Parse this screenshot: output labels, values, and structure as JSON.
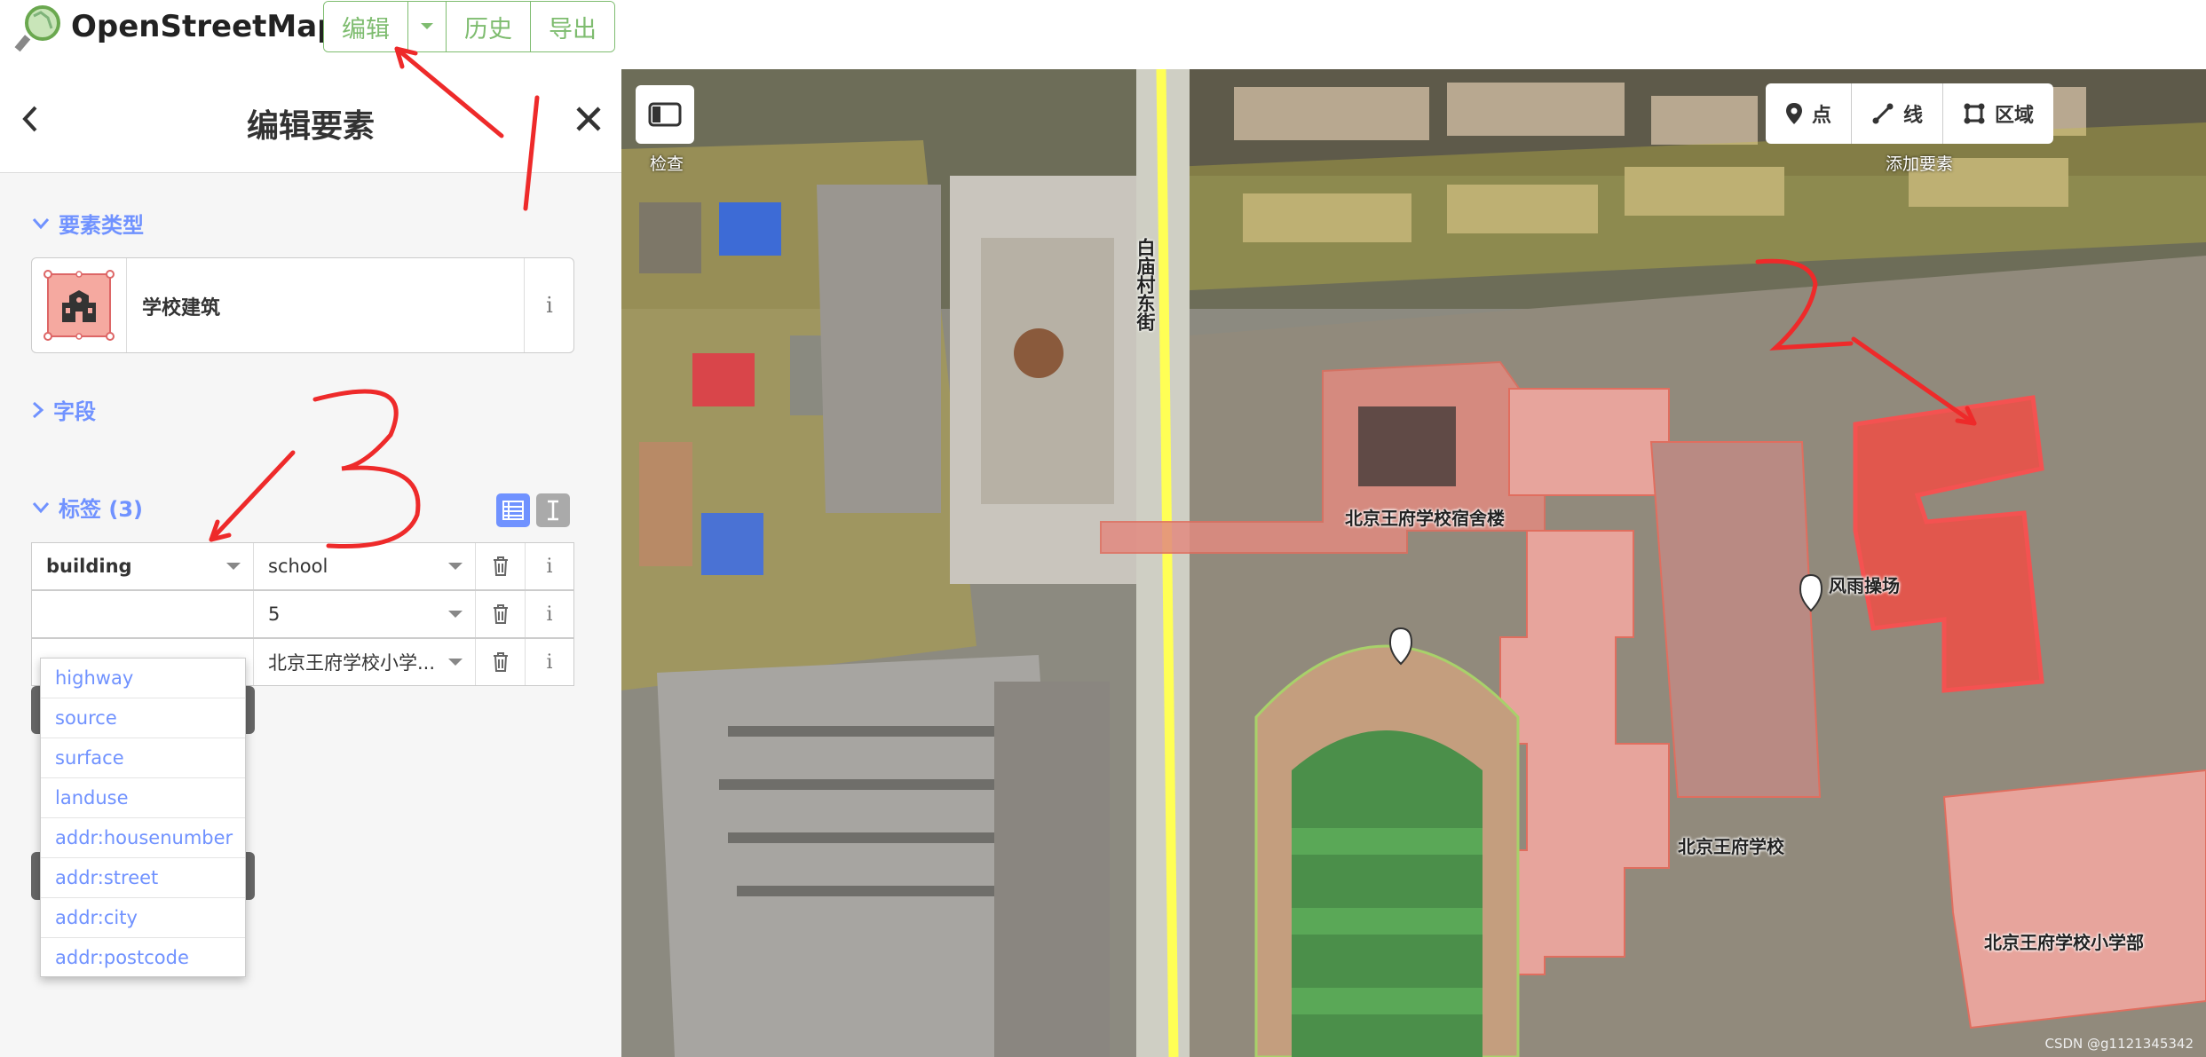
{
  "header": {
    "brand": "OpenStreetMap",
    "edit_label": "编辑",
    "history_label": "历史",
    "export_label": "导出"
  },
  "sidebar": {
    "title": "编辑要素",
    "preset_section": "要素类型",
    "preset_name": "学校建筑",
    "fields_section": "字段",
    "tags_section": "标签 (3)",
    "tags": [
      {
        "key": "building",
        "value": "school"
      },
      {
        "key": "",
        "value": "5"
      },
      {
        "key": "",
        "value": "北京王府学校小学..."
      }
    ],
    "key_suggestions": [
      "highway",
      "source",
      "surface",
      "landuse",
      "addr:housenumber",
      "addr:street",
      "addr:city",
      "addr:postcode"
    ]
  },
  "map": {
    "road_label": "白庙村东街",
    "labels": {
      "dorm": "北京王府学校宿舍楼",
      "field": "风雨操场",
      "school": "北京王府学校",
      "primary": "北京王府学校小学部"
    },
    "inspect_caption": "检查",
    "add_caption": "添加要素",
    "add_point": "点",
    "add_line": "线",
    "add_area": "区域",
    "credit": "CSDN @g1121345342"
  },
  "annotations": [
    "1",
    "2",
    "3"
  ],
  "colors": {
    "osm_green": "#7ebc6f",
    "accent_blue": "#7092ff",
    "building_red": "#e06e5f",
    "selected_red": "#ff4d4d"
  }
}
